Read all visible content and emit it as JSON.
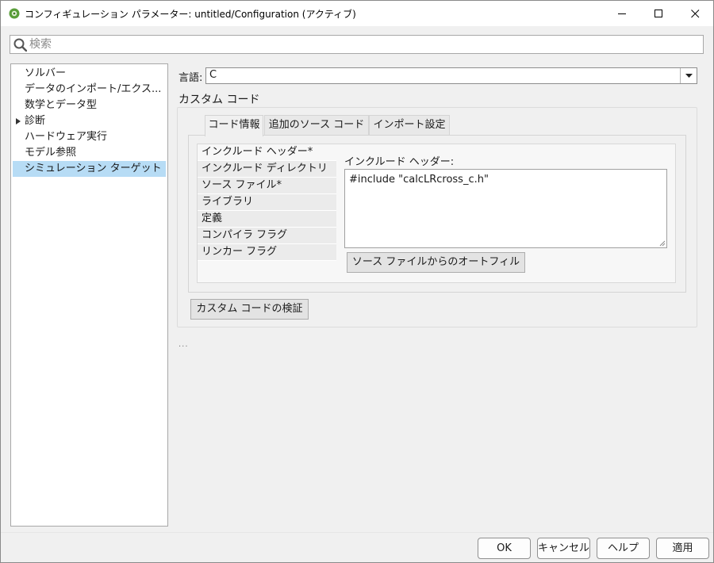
{
  "window": {
    "title": "コンフィギュレーション パラメーター: untitled/Configuration (アクティブ)",
    "app_icon": "matlab-simulink-icon",
    "controls": {
      "minimize_icon": "minimize-icon",
      "maximize_icon": "maximize-icon",
      "close_icon": "close-icon"
    }
  },
  "search": {
    "placeholder": "検索",
    "value": "",
    "icon": "search-icon"
  },
  "tree": {
    "items": [
      {
        "label": "ソルバー",
        "selected": false,
        "expandable": false
      },
      {
        "label": "データのインポート/エクス...",
        "selected": false,
        "expandable": false
      },
      {
        "label": "数学とデータ型",
        "selected": false,
        "expandable": false
      },
      {
        "label": "診断",
        "selected": false,
        "expandable": true
      },
      {
        "label": "ハードウェア実行",
        "selected": false,
        "expandable": false
      },
      {
        "label": "モデル参照",
        "selected": false,
        "expandable": false
      },
      {
        "label": "シミュレーション ターゲット",
        "selected": true,
        "expandable": false
      }
    ]
  },
  "main": {
    "language_label": "言語:",
    "language_value": "C",
    "section_title": "カスタム コード",
    "tabs": [
      {
        "label": "コード情報",
        "active": true
      },
      {
        "label": "追加のソース コード",
        "active": false
      },
      {
        "label": "インポート設定",
        "active": false
      }
    ],
    "subitems": [
      {
        "label": "インクルード ヘッダー*",
        "selected": true
      },
      {
        "label": "インクルード ディレクトリ",
        "selected": false
      },
      {
        "label": "ソース ファイル*",
        "selected": false
      },
      {
        "label": "ライブラリ",
        "selected": false
      },
      {
        "label": "定義",
        "selected": false
      },
      {
        "label": "コンパイラ フラグ",
        "selected": false
      },
      {
        "label": "リンカー フラグ",
        "selected": false
      }
    ],
    "include_header_label": "インクルード ヘッダー:",
    "include_header_value": "#include \"calcLRcross_c.h\"",
    "autofill_button": "ソース ファイルからのオートフィル",
    "validate_button": "カスタム コードの検証",
    "ellipsis": "..."
  },
  "footer": {
    "ok": "OK",
    "cancel": "キャンセル",
    "help": "ヘルプ",
    "apply": "適用"
  },
  "colors": {
    "selection": "#b7dcf5",
    "background": "#f0f0f0",
    "border": "#a8a8a8"
  }
}
